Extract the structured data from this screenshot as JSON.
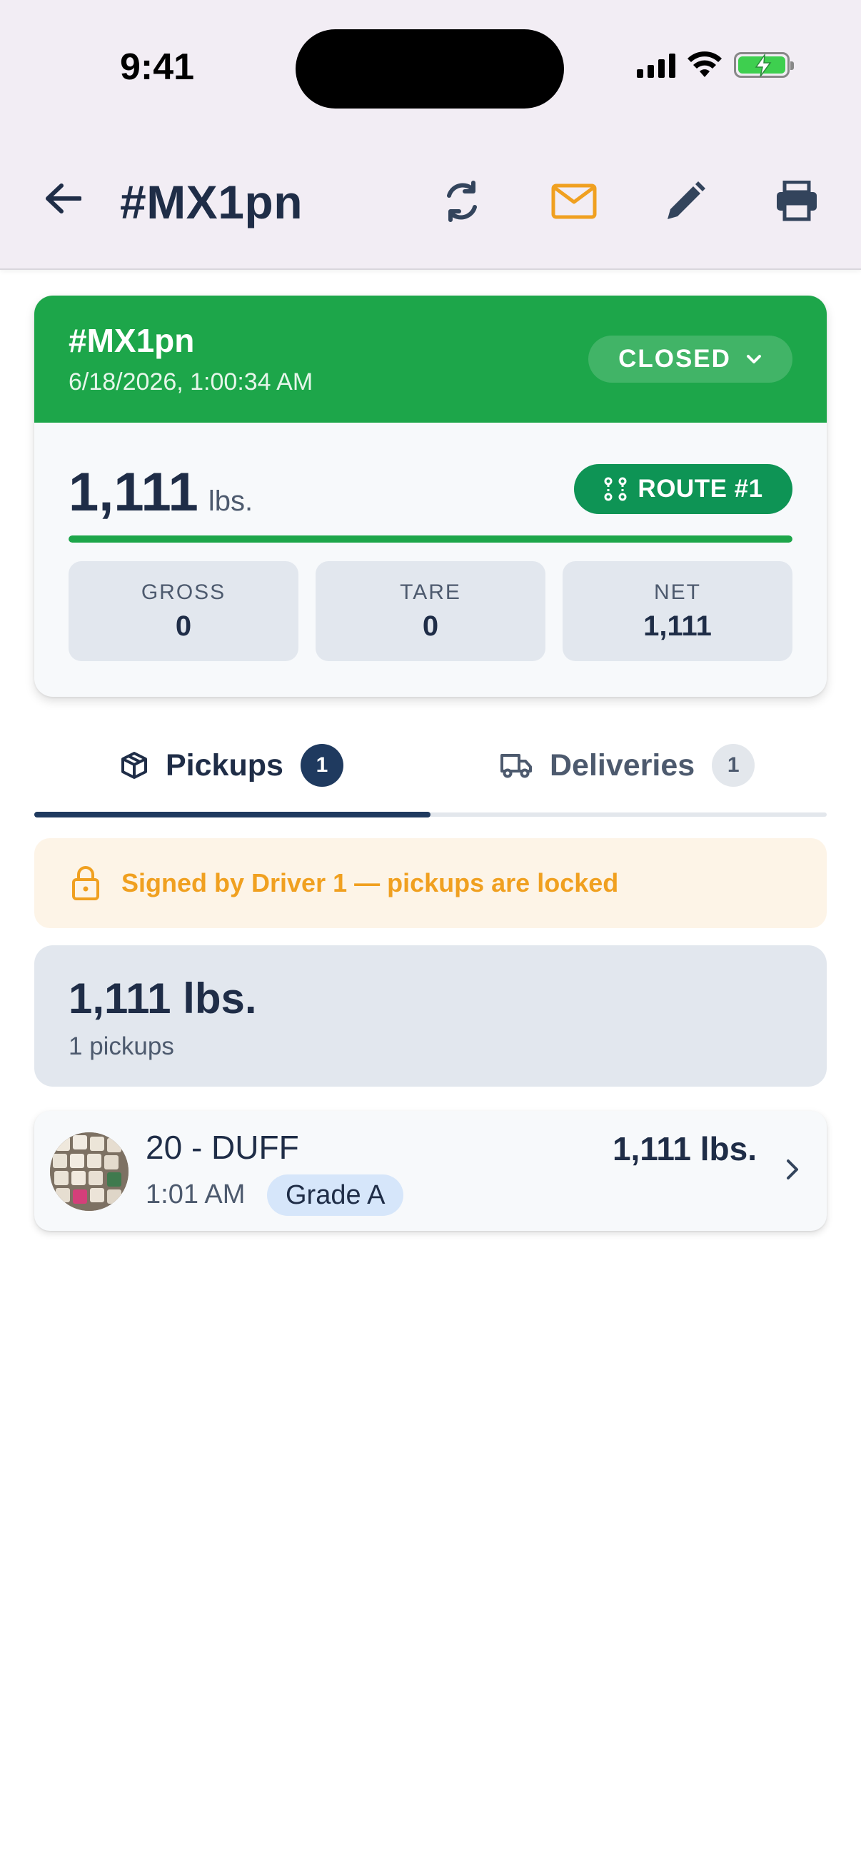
{
  "status_bar": {
    "time": "9:41"
  },
  "app_bar": {
    "title": "#MX1pn",
    "back_icon": "arrow-left-icon",
    "actions": [
      "sync-icon",
      "mail-icon",
      "pencil-icon",
      "printer-icon"
    ],
    "accent_mail_color": "#f0a020"
  },
  "summary": {
    "title": "#MX1pn",
    "datetime": "6/18/2026, 1:00:34 AM",
    "status": "CLOSED",
    "header_color": "#1da64a",
    "weight": "1,111",
    "weight_unit": "lbs.",
    "route": "ROUTE #1",
    "progress": 1.0,
    "stats": [
      {
        "label": "GROSS",
        "value": "0"
      },
      {
        "label": "TARE",
        "value": "0"
      },
      {
        "label": "NET",
        "value": "1,111"
      }
    ]
  },
  "tabs": [
    {
      "label": "Pickups",
      "count": "1",
      "active": true
    },
    {
      "label": "Deliveries",
      "count": "1",
      "active": false
    }
  ],
  "notice": {
    "text": "Signed by Driver 1 — pickups are locked",
    "color": "#f0a020"
  },
  "totals": {
    "weight": "1,111 lbs.",
    "count": "1 pickups"
  },
  "pickups": [
    {
      "name": "20 - DUFF",
      "time": "1:01 AM",
      "grade": "Grade A",
      "weight": "1,111 lbs."
    }
  ]
}
